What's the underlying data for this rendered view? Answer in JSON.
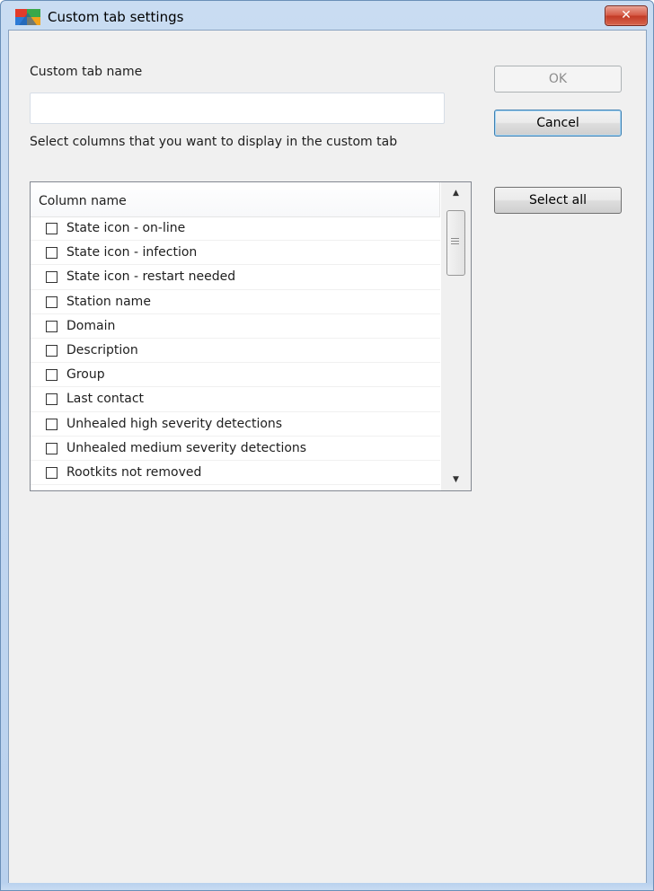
{
  "window": {
    "title": "Custom tab settings",
    "close_glyph": "✕"
  },
  "form": {
    "tab_name_label": "Custom tab name",
    "tab_name_value": "",
    "columns_prompt": "Select columns that you want to display in the custom tab"
  },
  "buttons": {
    "ok": "OK",
    "cancel": "Cancel",
    "select_all": "Select all"
  },
  "columns_list": {
    "header": "Column name",
    "items": [
      {
        "label": "State icon - on-line",
        "checked": false
      },
      {
        "label": "State icon - infection",
        "checked": false
      },
      {
        "label": "State icon - restart needed",
        "checked": false
      },
      {
        "label": "Station name",
        "checked": false
      },
      {
        "label": "Domain",
        "checked": false
      },
      {
        "label": "Description",
        "checked": false
      },
      {
        "label": "Group",
        "checked": false
      },
      {
        "label": "Last contact",
        "checked": false
      },
      {
        "label": "Unhealed high severity detections",
        "checked": false
      },
      {
        "label": "Unhealed medium severity detections",
        "checked": false
      },
      {
        "label": "Rootkits not removed",
        "checked": false
      }
    ],
    "scroll_up_glyph": "▲",
    "scroll_down_glyph": "▼"
  },
  "icons": {
    "app_logo": "avg-logo-icon",
    "close": "close-icon"
  },
  "colors": {
    "window_frame": "#b9d1ee",
    "close_button": "#c23a26",
    "client_bg": "#f0f0f0"
  }
}
